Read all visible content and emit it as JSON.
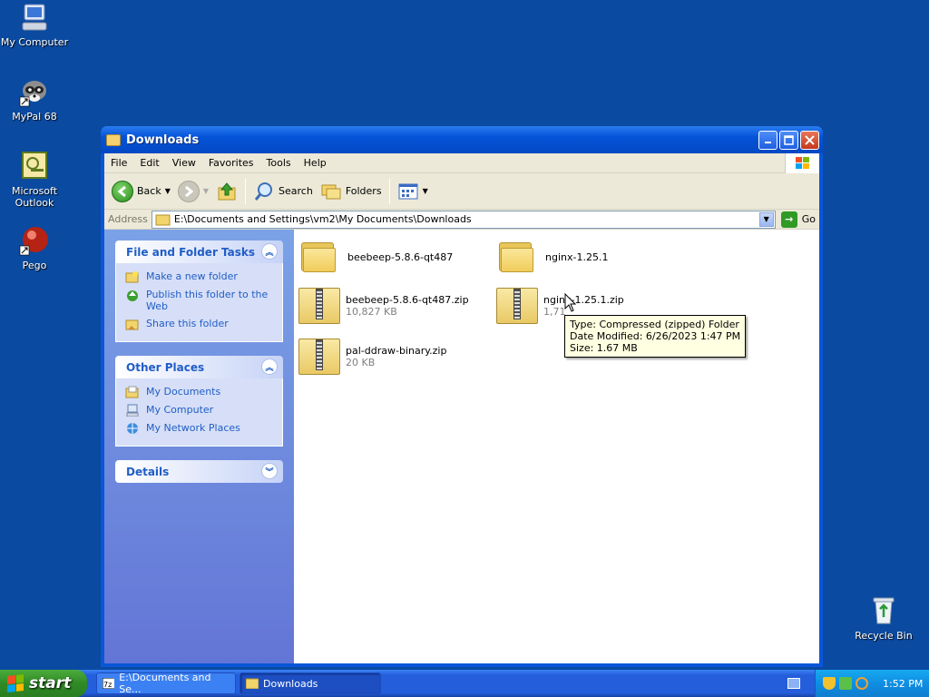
{
  "desktop": {
    "icons": [
      {
        "label": "My Computer"
      },
      {
        "label": "MyPal 68"
      },
      {
        "label": "Microsoft Outlook"
      },
      {
        "label": "Pego"
      },
      {
        "label": "Recycle Bin"
      }
    ]
  },
  "window": {
    "title": "Downloads",
    "menu": [
      "File",
      "Edit",
      "View",
      "Favorites",
      "Tools",
      "Help"
    ],
    "toolbar": {
      "back": "Back",
      "search": "Search",
      "folders": "Folders"
    },
    "address": {
      "label": "Address",
      "path": "E:\\Documents and Settings\\vm2\\My Documents\\Downloads",
      "go": "Go"
    }
  },
  "taskpane": {
    "file_tasks": {
      "title": "File and Folder Tasks",
      "links": [
        "Make a new folder",
        "Publish this folder to the Web",
        "Share this folder"
      ]
    },
    "other_places": {
      "title": "Other Places",
      "links": [
        "My Documents",
        "My Computer",
        "My Network Places"
      ]
    },
    "details": {
      "title": "Details"
    }
  },
  "files": [
    {
      "name": "beebeep-5.8.6-qt487",
      "type": "folder",
      "size": ""
    },
    {
      "name": "nginx-1.25.1",
      "type": "folder",
      "size": ""
    },
    {
      "name": "beebeep-5.8.6-qt487.zip",
      "type": "zip",
      "size": "10,827 KB"
    },
    {
      "name": "nginx-1.25.1.zip",
      "type": "zip",
      "size": "1,71"
    },
    {
      "name": "pal-ddraw-binary.zip",
      "type": "zip",
      "size": "20 KB"
    }
  ],
  "tooltip": {
    "type": "Type: Compressed (zipped) Folder",
    "modified": "Date Modified: 6/26/2023 1:47 PM",
    "size": "Size: 1.67 MB"
  },
  "taskbar": {
    "start": "start",
    "tasks": [
      "E:\\Documents and Se...",
      "Downloads"
    ],
    "clock": "1:52 PM"
  }
}
